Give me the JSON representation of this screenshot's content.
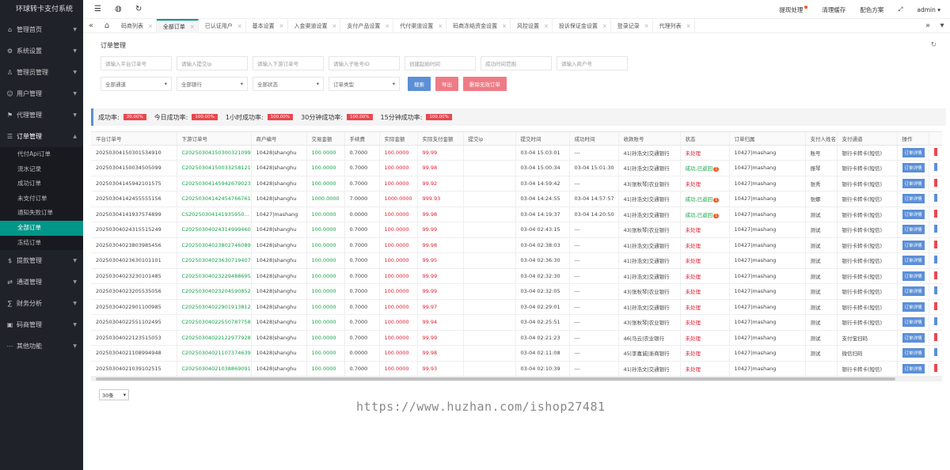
{
  "app": {
    "title": "环球转卡支付系统"
  },
  "sidebar": {
    "items": [
      {
        "label": "管理首页",
        "icon": "home-icon"
      },
      {
        "label": "系统设置",
        "icon": "gear-icon"
      },
      {
        "label": "管理员管理",
        "icon": "admin-icon"
      },
      {
        "label": "用户管理",
        "icon": "user-icon"
      },
      {
        "label": "代理管理",
        "icon": "agent-icon"
      },
      {
        "label": "订单管理",
        "icon": "order-icon"
      },
      {
        "label": "提款管理",
        "icon": "withdraw-icon"
      },
      {
        "label": "通道管理",
        "icon": "channel-icon"
      },
      {
        "label": "财务分析",
        "icon": "finance-icon"
      },
      {
        "label": "码商管理",
        "icon": "merchant-icon"
      },
      {
        "label": "其他功能",
        "icon": "more-icon"
      }
    ],
    "order_sub": [
      "代付Api订单",
      "流水记录",
      "成功订单",
      "未支付订单",
      "通知失败订单",
      "全部订单",
      "冻结订单"
    ]
  },
  "topbar": {
    "withdraw": "提现处理",
    "clear_cache": "清理缓存",
    "color_scheme": "配色方案",
    "user": "admin"
  },
  "tabs": [
    "码商列表",
    "全部订单",
    "已认证用户",
    "基本设置",
    "入金渠道设置",
    "支付产品设置",
    "代付渠道设置",
    "码商冻结资金设置",
    "风控设置",
    "投诉保证金设置",
    "登录记录",
    "代理列表"
  ],
  "page": {
    "title": "订单管理"
  },
  "filters": {
    "platform_order": "请输入平台订单号",
    "submit_ip": "请输入提交ip",
    "downstream_order": "请输入下游订单号",
    "sub_account": "请输入子账号ID",
    "create_time": "创建起始时间",
    "success_time": "成功时间范围",
    "merchant_no": "请输入商户号",
    "channel": "全部通道",
    "bank": "全部银行",
    "status": "全部状态",
    "order_type": "订单类型",
    "search": "搜索",
    "export": "导出",
    "delete_invalid": "删除无效订单"
  },
  "stats": [
    {
      "label": "成功率:",
      "value": "20.00%"
    },
    {
      "label": "今日成功率:",
      "value": "100.00%"
    },
    {
      "label": "1小时成功率:",
      "value": "100.00%"
    },
    {
      "label": "30分钟成功率:",
      "value": "100.00%"
    },
    {
      "label": "15分钟成功率:",
      "value": "100.00%"
    }
  ],
  "table": {
    "headers": [
      "平台订单号",
      "下游订单号",
      "商户编号",
      "交易金额",
      "手续费",
      "实际金额",
      "实际支付金额",
      "提交ip",
      "提交时间",
      "成功时间",
      "收款账号",
      "状态",
      "订单归属",
      "支付人姓名",
      "支付通道",
      "操作"
    ],
    "detail_label": "订单详情",
    "badge": "1",
    "rows": [
      [
        "20250304150301534910",
        "C20250304150300321099",
        "10428|shanghu",
        "100.0000",
        "0.7000",
        "100.0000",
        "99.99",
        "",
        "03-04 15:03:01",
        "---",
        "41|孙浩文|交通银行",
        "未处理",
        "10427|mashang",
        "账号",
        "银行卡转卡(短信)"
      ],
      [
        "20250304150034505099",
        "C20250304150033258121",
        "10428|shanghu",
        "100.0000",
        "0.7000",
        "100.0000",
        "99.98",
        "",
        "03-04 15:00:34",
        "03-04 15:01:30",
        "41|孙浩文|交通银行",
        "成功,已返回",
        "10427|mashang",
        "振琴",
        "银行卡转卡(短信)"
      ],
      [
        "20250304145942101575",
        "C20250304145942679023",
        "10428|shanghu",
        "100.0000",
        "0.7000",
        "100.0000",
        "99.92",
        "",
        "03-04 14:59:42",
        "---",
        "43|张秋琴|农业银行",
        "未处理",
        "10427|mashang",
        "张秀",
        "银行卡转卡(短信)"
      ],
      [
        "20250304142455555156",
        "C20250304142454766761",
        "10428|shanghu",
        "1000.0000",
        "7.0000",
        "1000.0000",
        "999.93",
        "",
        "03-04 14:24:55",
        "03-04 14:57:57",
        "41|孙浩文|交通银行",
        "成功,已返回",
        "10427|mashang",
        "张娜",
        "银行卡转卡(短信)"
      ],
      [
        "20250304141937574899",
        "CS20250304141935950...",
        "10427|mashang",
        "100.0000",
        "0.0000",
        "100.0000",
        "99.98",
        "",
        "03-04 14:19:37",
        "03-04 14:20:50",
        "41|孙浩文|交通银行",
        "成功,已返回",
        "10427|mashang",
        "测试",
        "银行卡转卡(短信)"
      ],
      [
        "20250304024315515249",
        "C20250304024314999460",
        "10428|shanghu",
        "100.0000",
        "0.7000",
        "100.0000",
        "99.99",
        "",
        "03-04 02:43:15",
        "---",
        "43|张秋琴|农业银行",
        "未处理",
        "10427|mashang",
        "测试",
        "银行卡转卡(短信)"
      ],
      [
        "20250304023803985456",
        "C20250304023802746089",
        "10428|shanghu",
        "100.0000",
        "0.7000",
        "100.0000",
        "99.98",
        "",
        "03-04 02:38:03",
        "---",
        "41|孙浩文|交通银行",
        "未处理",
        "10427|mashang",
        "测试",
        "银行卡转卡(短信)"
      ],
      [
        "20250304023630101101",
        "C20250304023630719407",
        "10428|shanghu",
        "100.0000",
        "0.7000",
        "100.0000",
        "99.95",
        "",
        "03-04 02:36:30",
        "---",
        "41|孙浩文|交通银行",
        "未处理",
        "10427|mashang",
        "测试",
        "银行卡转卡(短信)"
      ],
      [
        "20250304023230101485",
        "C20250304023229488695",
        "10428|shanghu",
        "100.0000",
        "0.7000",
        "100.0000",
        "99.99",
        "",
        "03-04 02:32:30",
        "---",
        "41|孙浩文|交通银行",
        "未处理",
        "10427|mashang",
        "测试",
        "银行卡转卡(短信)"
      ],
      [
        "20250304023205535056",
        "C20250304023204590852",
        "10428|shanghu",
        "100.0000",
        "0.7000",
        "100.0000",
        "99.99",
        "",
        "03-04 02:32:05",
        "---",
        "43|张秋琴|农业银行",
        "未处理",
        "10427|mashang",
        "测试",
        "银行卡转卡(短信)"
      ],
      [
        "20250304022901100985",
        "C20250304022901913812",
        "10428|shanghu",
        "100.0000",
        "0.7000",
        "100.0000",
        "99.97",
        "",
        "03-04 02:29:01",
        "---",
        "41|孙浩文|交通银行",
        "未处理",
        "10427|mashang",
        "测试",
        "银行卡转卡(短信)"
      ],
      [
        "20250304022551102495",
        "C20250304022550787758",
        "10428|shanghu",
        "100.0000",
        "0.7000",
        "100.0000",
        "99.94",
        "",
        "03-04 02:25:51",
        "---",
        "43|张秋琴|农业银行",
        "未处理",
        "10427|mashang",
        "测试",
        "银行卡转卡(短信)"
      ],
      [
        "20250304022123515053",
        "C20250304022122977928",
        "10428|shanghu",
        "100.0000",
        "0.7000",
        "100.0000",
        "99.99",
        "",
        "03-04 02:21:23",
        "---",
        "46|马云|农业银行",
        "未处理",
        "10427|mashang",
        "测试",
        "支付宝扫码"
      ],
      [
        "20250304021108994948",
        "C20250304021107374639",
        "10428|shanghu",
        "100.0000",
        "0.0000",
        "100.0000",
        "99.98",
        "",
        "03-04 02:11:08",
        "---",
        "45|李嘉诚|浙商银行",
        "未处理",
        "10427|mashang",
        "测试",
        "微信扫码"
      ],
      [
        "20250304021039102515",
        "C20250304021038869091",
        "10428|shanghu",
        "100.0000",
        "0.7000",
        "100.0000",
        "99.93",
        "",
        "03-04 02:10:39",
        "---",
        "41|孙浩文|交通银行",
        "未处理",
        "10427|mashang",
        "",
        "银行卡转卡(短信)"
      ]
    ]
  },
  "pager": {
    "per_page": "30条"
  },
  "watermark": "https://www.huzhan.com/ishop27481",
  "colors": {
    "accent": "#009688",
    "primary_btn": "#5b8fd6",
    "danger": "#e11d2f",
    "success": "#16a34a",
    "badge": "#e8484f"
  }
}
